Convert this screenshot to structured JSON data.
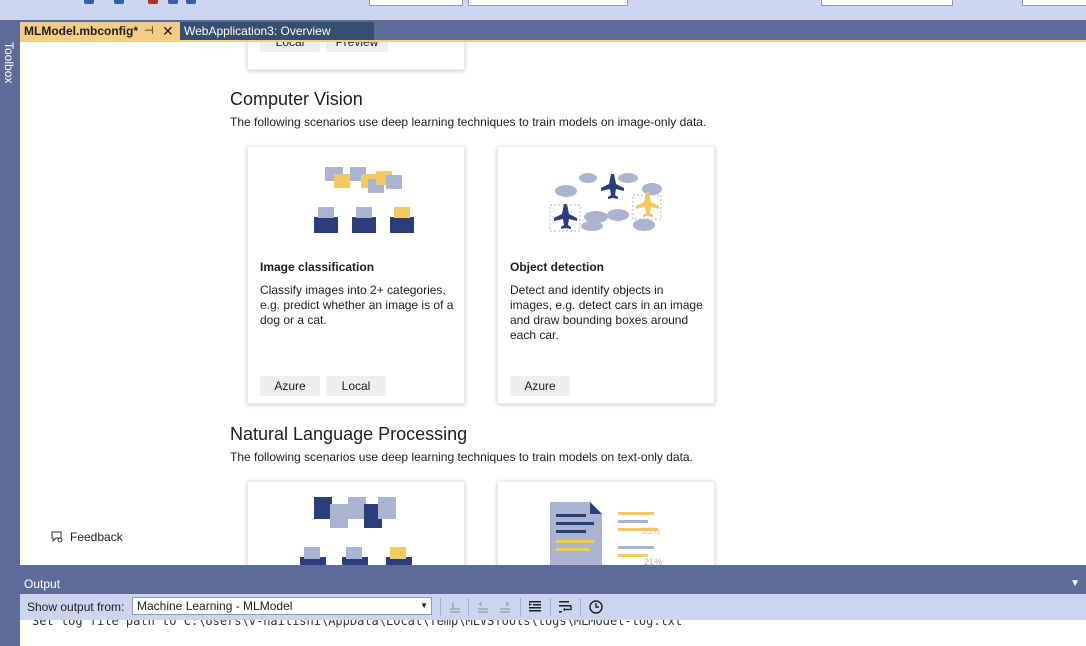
{
  "window": {
    "toolbox_label": "Toolbox",
    "tabs": [
      {
        "label": "MLModel.mbconfig*",
        "pin": "⊣",
        "close": "✕"
      },
      {
        "label": "WebApplication3: Overview"
      }
    ]
  },
  "top_card": {
    "tags": [
      "Local",
      "Preview"
    ]
  },
  "sections": {
    "computer_vision": {
      "title": "Computer Vision",
      "description": "The following scenarios use deep learning techniques to train models on image-only data.",
      "cards": [
        {
          "title": "Image classification",
          "description": "Classify images into 2+ categories, e.g. predict whether an image is of a dog or a cat.",
          "tags": [
            "Azure",
            "Local"
          ]
        },
        {
          "title": "Object detection",
          "description": "Detect and identify objects in images, e.g. detect cars in an image and draw bounding boxes around each car.",
          "tags": [
            "Azure"
          ]
        }
      ]
    },
    "nlp": {
      "title": "Natural Language Processing",
      "description": "The following scenarios use deep learning techniques to train models on text-only data.",
      "card_art_labels": [
        "95%",
        "21%"
      ]
    }
  },
  "feedback": {
    "label": "Feedback"
  },
  "output": {
    "title": "Output",
    "show_from_label": "Show output from:",
    "source": "Machine Learning - MLModel",
    "log_line": "Set log file path to C:\\Users\\v-hailishi\\AppData\\Local\\Temp\\MLVSTools\\logs\\MLModel-log.txt"
  },
  "colors": {
    "chrome": "#5d6b99",
    "active_tab": "#f5cc84",
    "inactive_tab": "#364e6f",
    "illustration_navy": "#2b3d7a",
    "illustration_yellow": "#f5c961",
    "illustration_gray": "#aab4d0"
  },
  "icons": [
    "pin-icon",
    "close-icon",
    "feedback-icon",
    "dropdown-arrow-icon",
    "clear-all-icon",
    "word-wrap-icon",
    "clock-icon"
  ]
}
